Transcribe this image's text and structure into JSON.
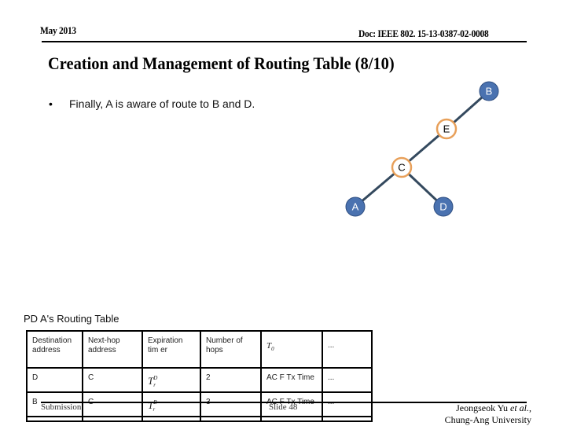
{
  "header": {
    "date": "May 2013",
    "doc_id": "Doc: IEEE 802. 15-13-0387-02-0008"
  },
  "slide": {
    "title": "Creation and Management of Routing Table (8/10)",
    "bullet_symbol": "•",
    "bullet_text": "Finally, A is aware of route to B and D."
  },
  "diagram": {
    "nodes": [
      {
        "id": "B",
        "label": "B",
        "style": "filled"
      },
      {
        "id": "E",
        "label": "E",
        "style": "ring"
      },
      {
        "id": "C",
        "label": "C",
        "style": "ring"
      },
      {
        "id": "A",
        "label": "A",
        "style": "filled"
      },
      {
        "id": "D",
        "label": "D",
        "style": "filled"
      }
    ],
    "edges": [
      {
        "from": "B",
        "to": "E"
      },
      {
        "from": "E",
        "to": "C"
      },
      {
        "from": "C",
        "to": "A"
      },
      {
        "from": "C",
        "to": "D"
      }
    ],
    "colors": {
      "filled_node": "#4a72b0",
      "filled_stroke": "#2f4f82",
      "ring_stroke": "#e8a05a",
      "edge": "#34495e",
      "filled_text": "#ffffff",
      "ring_text": "#000000"
    }
  },
  "routing_table": {
    "caption": "PD A's Routing Table",
    "headers": [
      {
        "line1": "Destination",
        "line2": "address"
      },
      {
        "line1": "Next-hop",
        "line2": "address"
      },
      {
        "line1": "Expiration",
        "line2": "tim er"
      },
      {
        "line1": "Number of",
        "line2": "hops"
      },
      {
        "line1": "T",
        "sub": "0"
      },
      {
        "line1": "..."
      }
    ],
    "rows": [
      {
        "destination": "D",
        "next_hop": "C",
        "timer_base": "T",
        "timer_sup": "D",
        "timer_sub": "r",
        "hops": "2",
        "t0": "AC F Tx Time",
        "more": "..."
      },
      {
        "destination": "B",
        "next_hop": "C",
        "timer_base": "T",
        "timer_sup": "B",
        "timer_sub": "r",
        "hops": "3",
        "t0": "AC F Tx Time",
        "more": "..."
      }
    ]
  },
  "footer": {
    "submission": "Submission",
    "slide": "Slide 48",
    "author_line1": "Jeongseok Yu ",
    "author_etal": "et al.",
    "author_suffix": ",",
    "author_line2": "Chung-Ang University"
  }
}
